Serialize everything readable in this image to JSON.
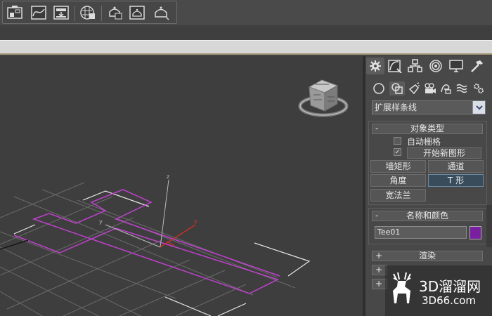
{
  "toolbar": {
    "icons": [
      "schematic-view-icon",
      "curve-editor-icon",
      "material-editor-icon",
      "render-setup-icon",
      "rendered-frame-icon",
      "render-icon",
      "render-iterative-icon"
    ]
  },
  "command_panel": {
    "tabs": [
      "create-tab",
      "modify-tab",
      "hierarchy-tab",
      "motion-tab",
      "display-tab",
      "utilities-tab"
    ],
    "categories": [
      "geometry",
      "shapes",
      "lights",
      "cameras",
      "helpers",
      "space-warps",
      "systems"
    ],
    "dropdown_value": "扩展样条线",
    "object_type": {
      "title": "对象类型",
      "auto_grid_label": "自动栅格",
      "auto_grid_checked": false,
      "start_new_shape_label": "开始新图形",
      "start_new_shape_checked": true,
      "buttons": [
        "墙矩形",
        "通道",
        "角度",
        "T 形",
        "宽法兰"
      ],
      "active_button": "T 形"
    },
    "name_color": {
      "title": "名称和颜色",
      "name": "Tee01",
      "color": "#7a1fa0"
    },
    "render_rollout": {
      "title": "渲染"
    },
    "minus_sign": "-",
    "plus_sign": "+"
  },
  "viewport": {
    "axis_labels": {
      "x": "x",
      "y": "y",
      "z": "z"
    },
    "shape_color": "#c040d0",
    "grid_color": "#6a6a6a"
  },
  "watermark": {
    "line1": "3D溜溜网",
    "line2": "3D66.com"
  }
}
